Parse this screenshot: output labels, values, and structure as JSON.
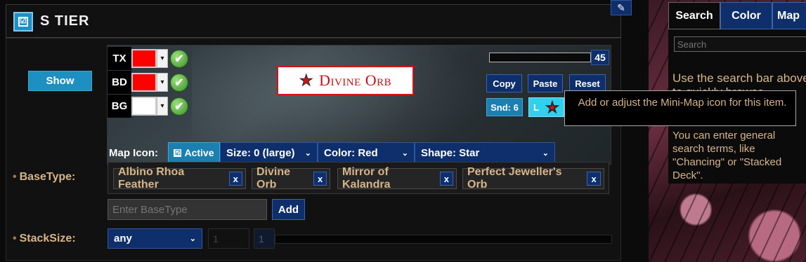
{
  "header": {
    "title": "S TIER",
    "check_glyph": "☑",
    "edit_icon": "✎"
  },
  "show_button": "Show",
  "colors": {
    "rows": [
      {
        "label": "TX",
        "swatch": "#ff0000"
      },
      {
        "label": "BD",
        "swatch": "#ff0000"
      },
      {
        "label": "BG",
        "swatch": "#ffffff"
      }
    ],
    "dropdown_glyph": "▾",
    "check_glyph": "✔"
  },
  "item_label": {
    "star": "★",
    "text": "Divine Orb"
  },
  "volume": {
    "value": "45"
  },
  "actions": {
    "copy": "Copy",
    "paste": "Paste",
    "reset": "Reset",
    "sound": "Snd: 6",
    "l_label": "L",
    "star": "★"
  },
  "map_icon": {
    "label": "Map Icon:",
    "active_check": "☑",
    "active": "Active",
    "size": "Size: 0 (large)",
    "color": "Color: Red",
    "shape": "Shape: Star",
    "chevron": "⌄"
  },
  "basetype": {
    "label": "BaseType:",
    "bullet": "•",
    "tags": [
      "Albino Rhoa Feather",
      "Divine Orb",
      "Mirror of Kalandra",
      "Perfect Jeweller's Orb"
    ],
    "remove": "x",
    "input_placeholder": "Enter BaseType",
    "add": "Add"
  },
  "stacksize": {
    "label": "StackSize:",
    "bullet": "•",
    "select": "any",
    "chevron": "⌄",
    "min": "1",
    "max": "1"
  },
  "right_panel": {
    "tabs": [
      "Search",
      "Color",
      "Map"
    ],
    "search_placeholder": "Search",
    "help1": "Use the search bar above to quickly browse",
    "help2": "You can enter general search terms, like \"Chancing\" or \"Stacked Deck\"."
  },
  "tooltip": "Add or adjust the Mini-Map icon for this item."
}
